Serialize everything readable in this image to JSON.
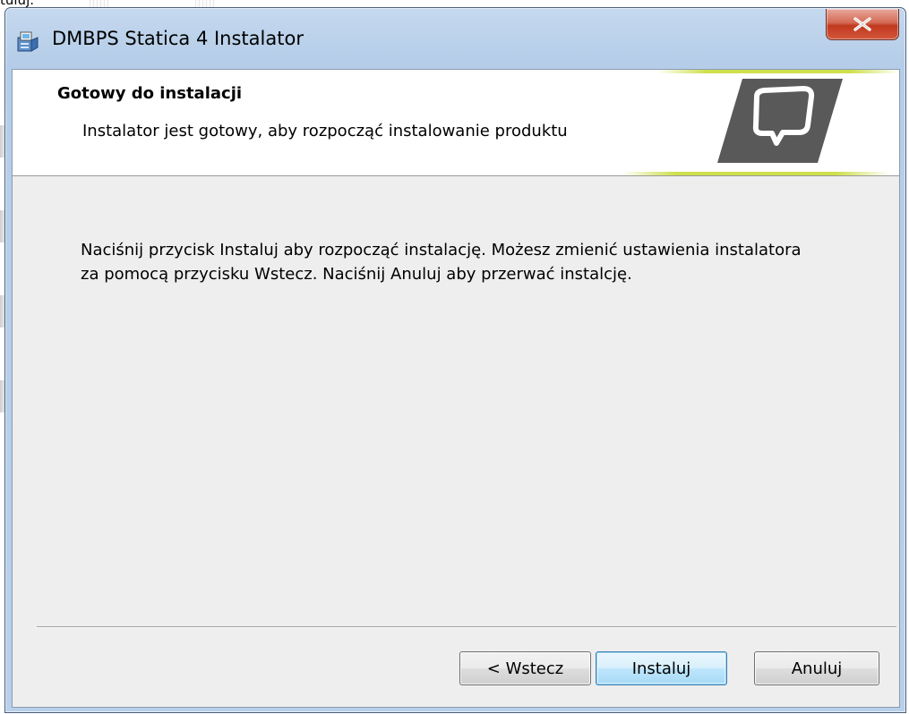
{
  "background": {
    "partial_text": "tuluj."
  },
  "window": {
    "title": "DMBPS Statica 4 Instalator",
    "title_icon": "installer-icon",
    "close_glyph": "close-icon"
  },
  "banner": {
    "title": "Gotowy do instalacji",
    "description": "Instalator jest gotowy, aby rozpocząć instalowanie produktu",
    "logo": "comarch-logo"
  },
  "body": {
    "line1": "Naciśnij przycisk Instaluj aby rozpocząć instalację. Możesz zmienić ustawienia instalatora",
    "line2": "za pomocą przycisku Wstecz. Naciśnij Anuluj aby przerwać instalcję."
  },
  "buttons": {
    "back_label": "< Wstecz",
    "install_label": "Instaluj",
    "cancel_label": "Anuluj"
  },
  "colors": {
    "accent_stripe": "#cfe04d",
    "close_button": "#c1391f",
    "default_button_border": "#3c7fb1"
  }
}
